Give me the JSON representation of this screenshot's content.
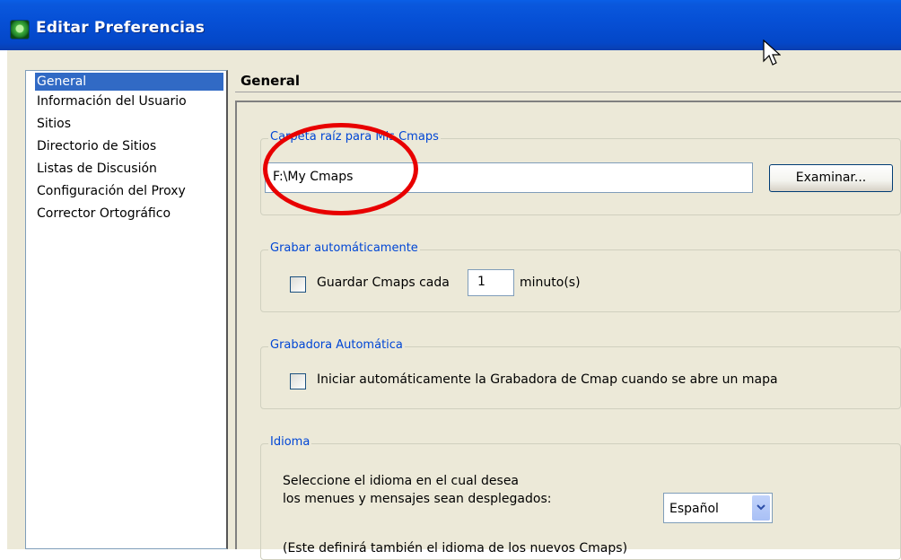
{
  "window": {
    "title": "Editar Preferencias",
    "icon": "cmap-app-icon"
  },
  "sidebar": {
    "items": [
      {
        "label": "General",
        "selected": true
      },
      {
        "label": "Información del Usuario",
        "selected": false
      },
      {
        "label": "Sitios",
        "selected": false
      },
      {
        "label": "Directorio de Sitios",
        "selected": false
      },
      {
        "label": "Listas de Discusión",
        "selected": false
      },
      {
        "label": "Configuración del Proxy",
        "selected": false
      },
      {
        "label": "Corrector Ortográfico",
        "selected": false
      }
    ]
  },
  "header": {
    "title": "General"
  },
  "root_folder": {
    "legend": "Carpeta raíz para Mis Cmaps",
    "path_value": "F:\\My Cmaps",
    "browse_label": "Examinar..."
  },
  "autosave": {
    "legend": "Grabar automáticamente",
    "checkbox_label": "Guardar Cmaps cada",
    "interval_value": "1",
    "unit_label": "minuto(s)",
    "checked": false
  },
  "recorder": {
    "legend": "Grabadora Automática",
    "checkbox_label": "Iniciar automáticamente la Grabadora de Cmap cuando se abre un mapa",
    "checked": false
  },
  "language": {
    "legend": "Idioma",
    "prompt_line1": "Seleccione el idioma en el cual desea",
    "prompt_line2": "los menues y mensajes sean desplegados:",
    "selected": "Español",
    "note": "(Este definirá también el idioma de los nuevos Cmaps)"
  },
  "colors": {
    "titlebar": "#0650d6",
    "selection": "#316ac5",
    "legend_text": "#0046d5",
    "highlight_ellipse": "#e80000"
  }
}
